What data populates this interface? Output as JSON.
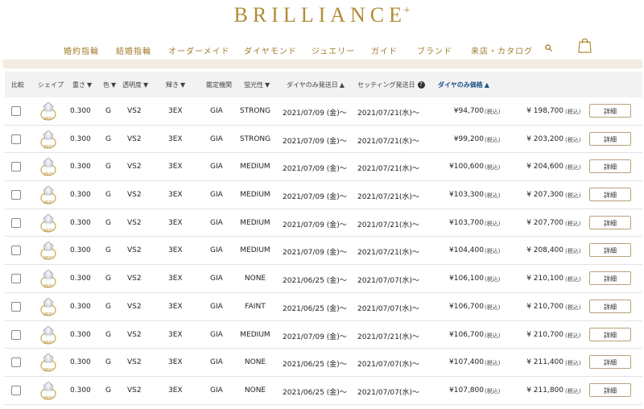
{
  "brand": {
    "logo_text": "BRILLIANCE",
    "logo_plus": "+"
  },
  "nav": {
    "items": [
      "婚約指輪",
      "結婚指輪",
      "オーダーメイド",
      "ダイヤモンド",
      "ジュエリー",
      "ガイド",
      "ブランド",
      "来店・カタログ"
    ]
  },
  "table": {
    "headers": {
      "compare": "比較",
      "shape": "シェイプ",
      "weight": "重さ",
      "color": "色",
      "clarity": "透明度",
      "cut": "輝き",
      "lab": "鑑定機関",
      "fluor": "蛍光性",
      "diamond_ship": "ダイヤのみ発送日",
      "setting_ship": "セッティング発送日",
      "diamond_price": "ダイヤのみ価格"
    },
    "thumb_label": "360°",
    "tax_label": "(税込)",
    "detail_label": "詳細",
    "rows": [
      {
        "weight": "0.300",
        "color": "G",
        "clarity": "VS2",
        "cut": "3EX",
        "lab": "GIA",
        "fluor": "STRONG",
        "diamond_ship": "2021/07/09 (金)〜",
        "setting_ship": "2021/07/21(水)〜",
        "diamond_price": "¥94,700",
        "setting_price": "¥ 198,700"
      },
      {
        "weight": "0.300",
        "color": "G",
        "clarity": "VS2",
        "cut": "3EX",
        "lab": "GIA",
        "fluor": "STRONG",
        "diamond_ship": "2021/07/09 (金)〜",
        "setting_ship": "2021/07/21(水)〜",
        "diamond_price": "¥99,200",
        "setting_price": "¥ 203,200"
      },
      {
        "weight": "0.300",
        "color": "G",
        "clarity": "VS2",
        "cut": "3EX",
        "lab": "GIA",
        "fluor": "MEDIUM",
        "diamond_ship": "2021/07/09 (金)〜",
        "setting_ship": "2021/07/21(水)〜",
        "diamond_price": "¥100,600",
        "setting_price": "¥ 204,600"
      },
      {
        "weight": "0.300",
        "color": "G",
        "clarity": "VS2",
        "cut": "3EX",
        "lab": "GIA",
        "fluor": "MEDIUM",
        "diamond_ship": "2021/07/09 (金)〜",
        "setting_ship": "2021/07/21(水)〜",
        "diamond_price": "¥103,300",
        "setting_price": "¥ 207,300"
      },
      {
        "weight": "0.300",
        "color": "G",
        "clarity": "VS2",
        "cut": "3EX",
        "lab": "GIA",
        "fluor": "MEDIUM",
        "diamond_ship": "2021/07/09 (金)〜",
        "setting_ship": "2021/07/21(水)〜",
        "diamond_price": "¥103,700",
        "setting_price": "¥ 207,700"
      },
      {
        "weight": "0.300",
        "color": "G",
        "clarity": "VS2",
        "cut": "3EX",
        "lab": "GIA",
        "fluor": "MEDIUM",
        "diamond_ship": "2021/07/09 (金)〜",
        "setting_ship": "2021/07/21(水)〜",
        "diamond_price": "¥104,400",
        "setting_price": "¥ 208,400"
      },
      {
        "weight": "0.300",
        "color": "G",
        "clarity": "VS2",
        "cut": "3EX",
        "lab": "GIA",
        "fluor": "NONE",
        "diamond_ship": "2021/06/25 (金)〜",
        "setting_ship": "2021/07/07(水)〜",
        "diamond_price": "¥106,100",
        "setting_price": "¥ 210,100"
      },
      {
        "weight": "0.300",
        "color": "G",
        "clarity": "VS2",
        "cut": "3EX",
        "lab": "GIA",
        "fluor": "FAINT",
        "diamond_ship": "2021/06/25 (金)〜",
        "setting_ship": "2021/07/07(水)〜",
        "diamond_price": "¥106,700",
        "setting_price": "¥ 210,700"
      },
      {
        "weight": "0.300",
        "color": "G",
        "clarity": "VS2",
        "cut": "3EX",
        "lab": "GIA",
        "fluor": "MEDIUM",
        "diamond_ship": "2021/07/09 (金)〜",
        "setting_ship": "2021/07/21(水)〜",
        "diamond_price": "¥106,700",
        "setting_price": "¥ 210,700"
      },
      {
        "weight": "0.300",
        "color": "G",
        "clarity": "VS2",
        "cut": "3EX",
        "lab": "GIA",
        "fluor": "NONE",
        "diamond_ship": "2021/06/25 (金)〜",
        "setting_ship": "2021/07/07(水)〜",
        "diamond_price": "¥107,400",
        "setting_price": "¥ 211,400"
      },
      {
        "weight": "0.300",
        "color": "G",
        "clarity": "VS2",
        "cut": "3EX",
        "lab": "GIA",
        "fluor": "NONE",
        "diamond_ship": "2021/06/25 (金)〜",
        "setting_ship": "2021/07/07(水)〜",
        "diamond_price": "¥107,800",
        "setting_price": "¥ 211,800"
      }
    ]
  },
  "colors": {
    "gold": "#b08d35",
    "active_header": "#1a4f8a"
  },
  "icons": {
    "search": "search-icon",
    "bag": "shopping-bag-icon",
    "help": "help-icon"
  }
}
